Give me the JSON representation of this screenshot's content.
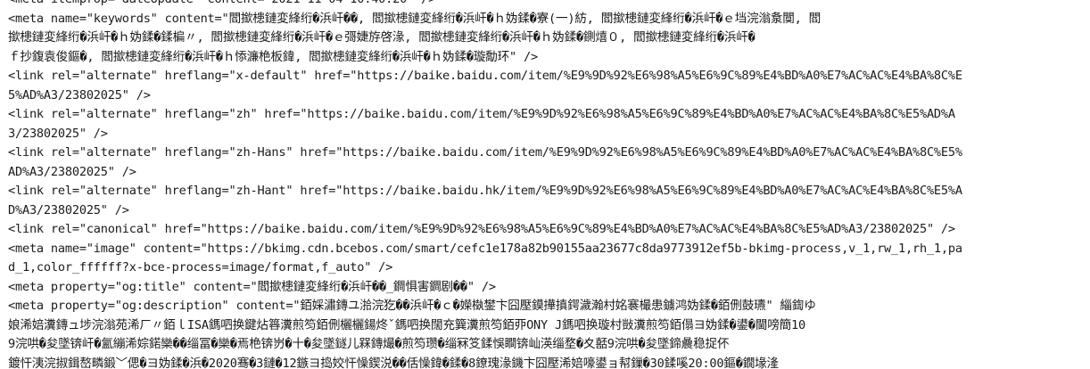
{
  "source_lines": [
    "<meta itemprop=\"dateUpdate\" content=\"2021-11-04 10:40:20\" />",
    "<meta name=\"keywords\" content=\"閻撳槵鏈変綘绗�浜屽��, 閻撳槵鏈変綘绗�浜屽�ｈ妫鍒�寮(一)紡, 閻撳槵鏈変綘绗�浜屽�ｅ垱浣滃洜闃, 閻",
    "撳槵鏈変綘绗�浜屽�ｈ妫鍒�鍒楄〃, 閻撳槵鏈変綘绗�浜屽�ｅ彁婕斿啓湪, 閻撳槵鏈変綘绗�浜屽�ｈ妫鍒�鍘熺０, 閻撳槵鏈変綘绗�浜屽�",
    "ｆ抄鍑袁俊鏂�, 閻撳槵鏈変綘绗�浜屽�ｈ悿濂栬板鍏, 閻撳槵鏈変綘绗�浜屽�ｈ妫鍒�璇勪环\" />",
    "<link rel=\"alternate\" hreflang=\"x-default\" href=\"https://baike.baidu.com/item/%E9%9D%92%E6%98%A5%E6%9C%89%E4%BD%A0%E7%AC%AC%E4%BA%8C%E",
    "5%AD%A3/23802025\" />",
    "<link rel=\"alternate\" hreflang=\"zh\" href=\"https://baike.baidu.com/item/%E9%9D%92%E6%98%A5%E6%9C%89%E4%BD%A0%E7%AC%AC%E4%BA%8C%E5%AD%A",
    "3/23802025\" />",
    "<link rel=\"alternate\" hreflang=\"zh-Hans\" href=\"https://baike.baidu.com/item/%E9%9D%92%E6%98%A5%E6%9C%89%E4%BD%A0%E7%AC%AC%E4%BA%8C%E5%",
    "AD%A3/23802025\" />",
    "<link rel=\"alternate\" hreflang=\"zh-Hant\" href=\"https://baike.baidu.hk/item/%E9%9D%92%E6%98%A5%E6%9C%89%E4%BD%A0%E7%AC%AC%E4%BA%8C%E5%A",
    "D%A3/23802025\" />",
    "<link rel=\"canonical\" href=\"https://baike.baidu.com/item/%E9%9D%92%E6%98%A5%E6%9C%89%E4%BD%A0%E7%AC%AC%E4%BA%8C%E5%AD%A3/23802025\" />",
    "<meta name=\"image\" content=\"https://bkimg.cdn.bcebos.com/smart/cefc1e178a82b90155aa23677c8da9773912ef5b-bkimg-process,v_1,rw_1,rh_1,pa",
    "d_1,color_ffffff?x-bce-process=image/format,f_auto\" />",
    "<meta property=\"og:title\" content=\"閻撳槵鏈変綘绗�浜屽��_鐧惧害鐧剧��\" />",
    "<meta property=\"og:description\" content=\"銆婇潚鏄ユ湁浣犵��浜屽�ｃ�嬫槸鐢卞囧壓鏌撶搷鍔濊瀚村姳褰樶患鐪鸿妫鍒�銆侀鼓瓙\" 緇鍧ゆ",
    "娘浠婄瀵鏄ュ埗浣滃苑浠ㄏ〃銆ｌISA鎷呬换鍵炶簭瀵煎笉銆侀欐欐鍚炵ˇ鎷呬换闊充簨瀵煎笉銆丣ONY J鎷呬换璇村敱瀵煎笉銆傝ヨ妫鍒�鍙�閫嗙簡10",
    "9浣哄�夋墜锛屽�氳繃浠婃鍩欒��缁冨�欒�焉栬锛岃�十�夋墜鐩儿槑鏄熶�煎笉瓒�缁冧笅鍒悞瞷锛屾渶缁堥�夊嚭9浣哄�夋墜鍗曟稳捉伓",
    "鍍忓洟浣掓鍓嶅疄鍛﹀偲�ヨ妫鍒�浜�2020骞�3鏈�12鏃ヨ捣姣忓懆鍥涚��佸懆鍏�鍒�8鐐瑰湪鐖卞囧壓浠婄嚎鍙ョ幇鏁�30鍒嗘20:00鏂�鐗堟湰 "
  ]
}
